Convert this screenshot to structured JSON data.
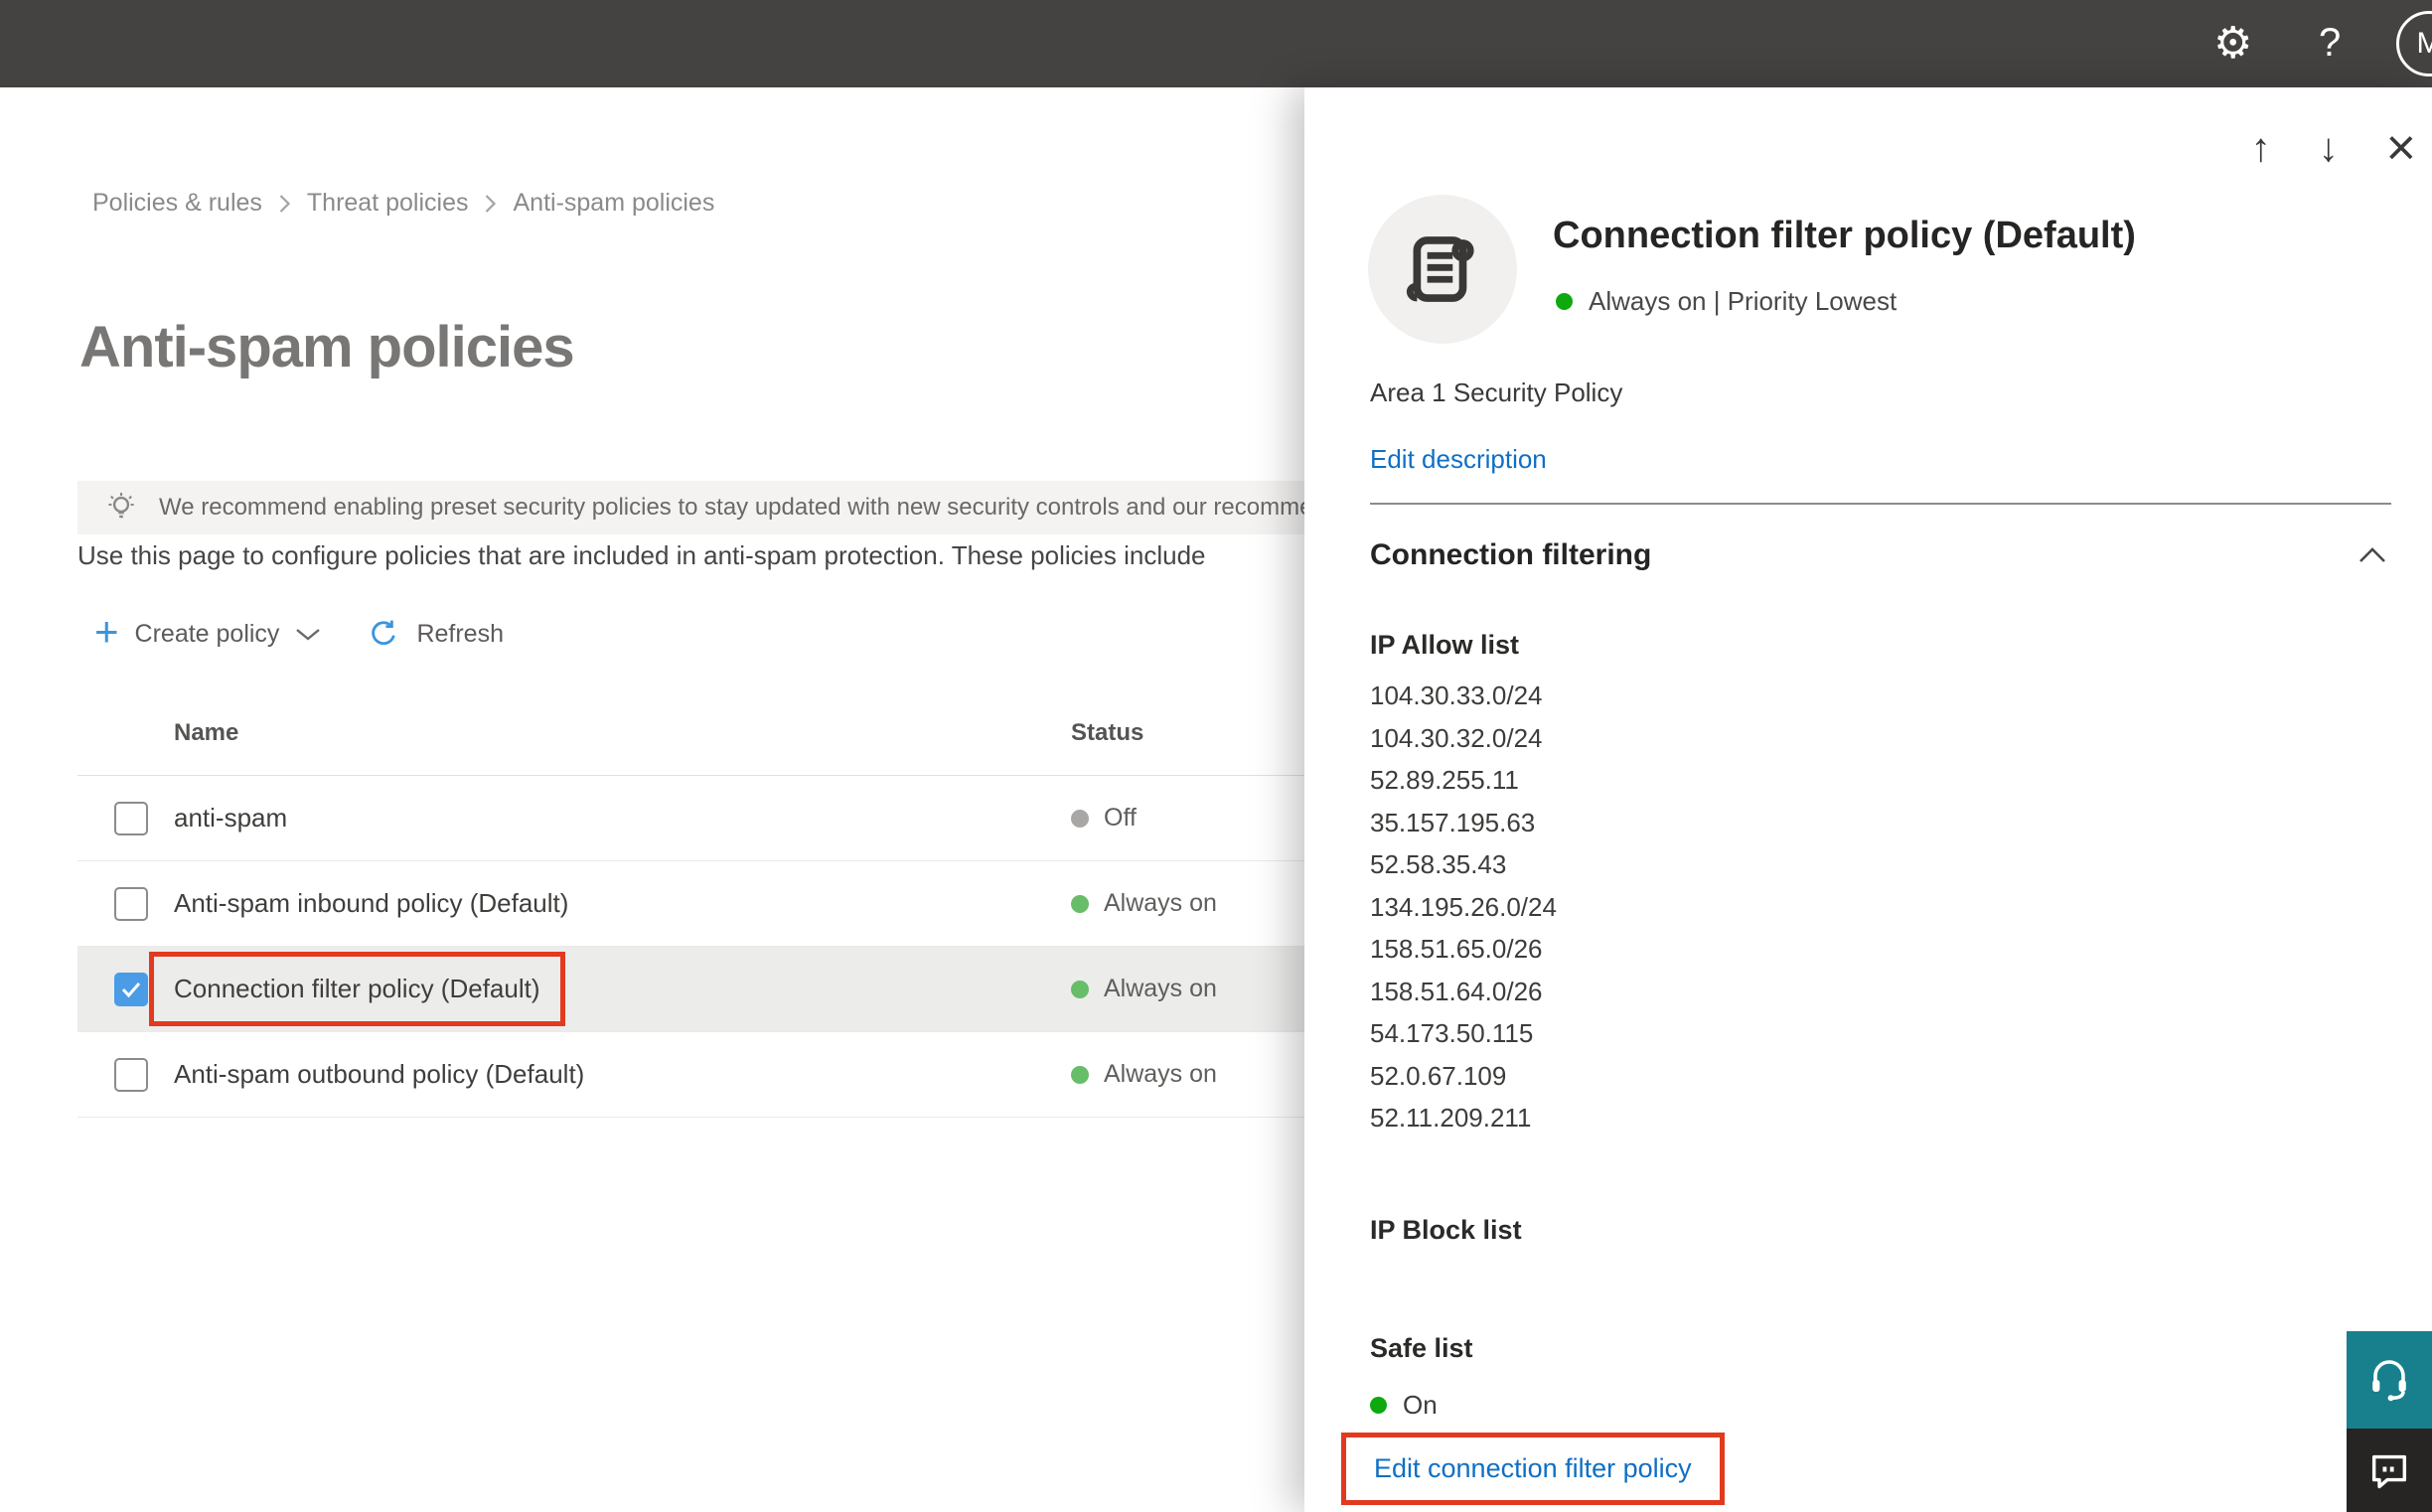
{
  "topbar": {
    "avatar_initial": "M"
  },
  "icons": {
    "gear": "⚙",
    "help": "?",
    "arrow_up": "↑",
    "arrow_down": "↓",
    "close": "×",
    "plus": "+"
  },
  "breadcrumb": {
    "items": [
      "Policies & rules",
      "Threat policies",
      "Anti-spam policies"
    ]
  },
  "page": {
    "title": "Anti-spam policies",
    "banner_text": "We recommend enabling preset security policies to stay updated with new security controls and our recomme",
    "description": "Use this page to configure policies that are included in anti-spam protection. These policies include",
    "toolbar": {
      "create_label": "Create policy",
      "refresh_label": "Refresh"
    },
    "table": {
      "columns": {
        "name": "Name",
        "status": "Status"
      },
      "rows": [
        {
          "name": "anti-spam",
          "status": "Off",
          "checked": false,
          "selected": false
        },
        {
          "name": "Anti-spam inbound policy (Default)",
          "status": "Always on",
          "checked": false,
          "selected": false
        },
        {
          "name": "Connection filter policy (Default)",
          "status": "Always on",
          "checked": true,
          "selected": true
        },
        {
          "name": "Anti-spam outbound policy (Default)",
          "status": "Always on",
          "checked": false,
          "selected": false
        }
      ]
    }
  },
  "panel": {
    "title": "Connection filter policy (Default)",
    "status_line": "Always on | Priority Lowest",
    "description": "Area 1 Security Policy",
    "edit_description_label": "Edit description",
    "section_title": "Connection filtering",
    "ip_allow": {
      "title": "IP Allow list",
      "ips": [
        "104.30.33.0/24",
        "104.30.32.0/24",
        "52.89.255.11",
        "35.157.195.63",
        "52.58.35.43",
        "134.195.26.0/24",
        "158.51.65.0/26",
        "158.51.64.0/26",
        "54.173.50.115",
        "52.0.67.109",
        "52.11.209.211"
      ]
    },
    "ip_block": {
      "title": "IP Block list"
    },
    "safe_list": {
      "title": "Safe list",
      "status": "On"
    },
    "edit_link_label": "Edit connection filter policy"
  },
  "colors": {
    "topbar_bg": "#454342",
    "link_blue": "#0f6fc5",
    "accent_blue": "#3a95dd",
    "checkbox_blue": "#4a9ce6",
    "callout_red": "#e23a1f",
    "status_green_soft": "#67bd68",
    "status_green_bright": "#0fa80f",
    "status_gray_off": "#a9a7a5",
    "support_teal": "#17808c",
    "feedback_dark": "#272524"
  }
}
